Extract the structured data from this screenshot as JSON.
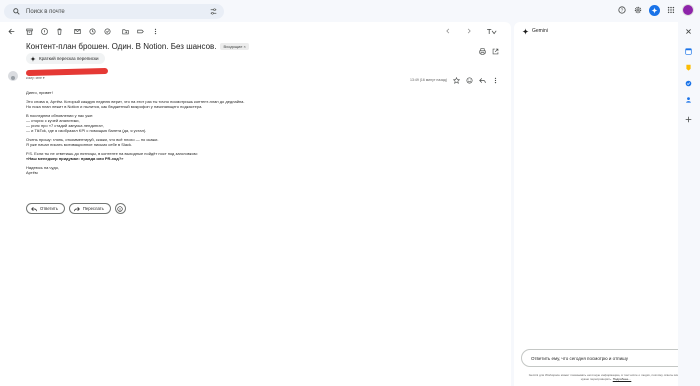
{
  "search": {
    "placeholder": "Поиск в почте"
  },
  "email": {
    "subject": "Контент-план брошен. Один. В Notion. Без шансов.",
    "label": "Входящие ×",
    "summary_chip": "Краткий пересказ переписки",
    "to_line": "кому: мне ▾",
    "time": "13:49 (16 минут назад)",
    "body": [
      [
        "Диего, привет!"
      ],
      [
        "Это снова я, Артём. Который каждую неделю верит, что на этот раз ты точно посмотришь контент-план до дедлайна.",
        "Но пока план лежит в Notion и пылится, как бюджетный микрофон у начинающего подкастера."
      ],
      [
        "В последнем обновлении у нас уже:",
        "— сторис с кучей аналитики,",
        "— рилс про «7 стадий запуска лендинга»,",
        "— и TikTok, где я изобразил KPI с помощью балета (да, я устал)."
      ],
      [
        "Очень прошу: глянь, откомментируй, скажи, что всё плохо — но скажи.",
        "Я уже начал писать мотивационное письмо себе в Slack."
      ],
      [
        "P.S. Если ты не ответишь до пятницы, в контенте на выходные пойдёт пост под заголовком:"
      ],
      [
        "Надеюсь на чудо,",
        "Артём"
      ]
    ],
    "ps_title": "«Наш менеджер придумал: правда или PR-ход?»",
    "reply_label": "Ответить",
    "forward_label": "Переслать"
  },
  "gemini": {
    "title": "Gemini",
    "input_text": "Ответить ему, что сегодня посмотрю и отпишу",
    "disclaimer": "Gemini для Workspace может показывать неточную информацию, в том числе о людях, поэтому ответы всегда нужно перепроверять.",
    "disclaimer_link": "Подробнее…"
  },
  "colors": {
    "accent": "#1a73e8",
    "redacted": "#e53935",
    "background": "#f6f8fc"
  }
}
